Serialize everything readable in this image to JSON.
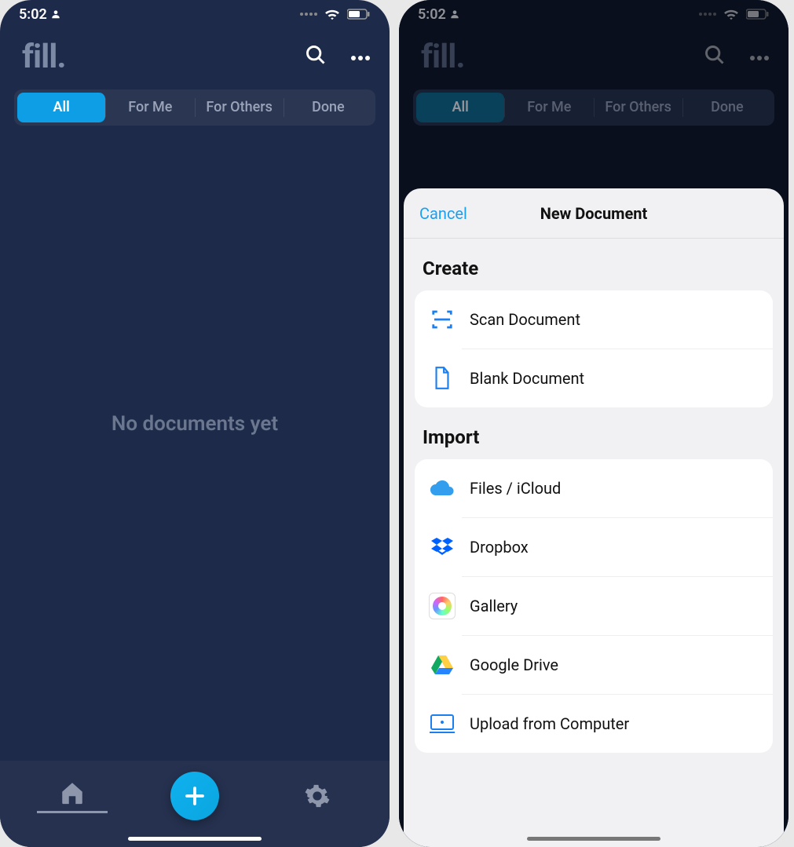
{
  "status": {
    "time": "5:02"
  },
  "header": {
    "logo": "fill."
  },
  "tabs": [
    "All",
    "For Me",
    "For Others",
    "Done"
  ],
  "empty_state": "No documents yet",
  "sheet": {
    "cancel": "Cancel",
    "title": "New Document",
    "create_section": "Create",
    "import_section": "Import",
    "create_items": [
      {
        "label": "Scan Document",
        "icon": "scan"
      },
      {
        "label": "Blank Document",
        "icon": "blank"
      }
    ],
    "import_items": [
      {
        "label": "Files / iCloud",
        "icon": "icloud"
      },
      {
        "label": "Dropbox",
        "icon": "dropbox"
      },
      {
        "label": "Gallery",
        "icon": "gallery"
      },
      {
        "label": "Google Drive",
        "icon": "gdrive"
      },
      {
        "label": "Upload from Computer",
        "icon": "computer"
      }
    ]
  }
}
